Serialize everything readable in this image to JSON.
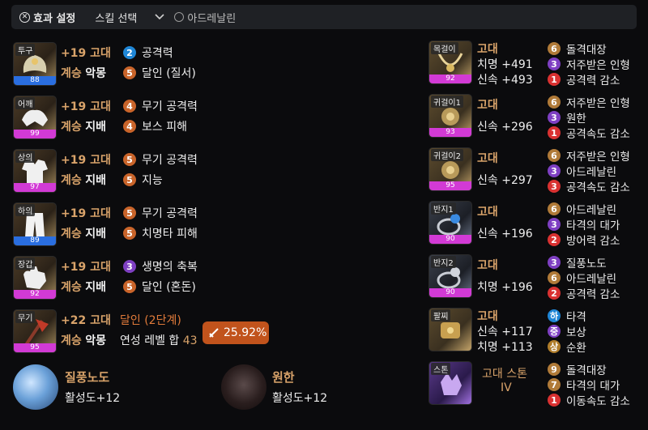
{
  "topbar": {
    "effects_label": "효과 설정",
    "skill_select_label": "스킬 선택",
    "adrenaline_label": "아드레날린"
  },
  "armor": [
    {
      "slot": "투구",
      "quality": "88",
      "quality_color": "blue",
      "upgrade": "+19 고대",
      "succession": "계승",
      "set_name": "악몽",
      "effects": [
        {
          "level": "2",
          "color": "#1f86d6",
          "text": "공격력"
        },
        {
          "level": "5",
          "color": "#c9642a",
          "text": "달인 (질서)"
        }
      ]
    },
    {
      "slot": "어깨",
      "quality": "99",
      "quality_color": "pink",
      "upgrade": "+19 고대",
      "succession": "계승",
      "set_name": "지배",
      "effects": [
        {
          "level": "4",
          "color": "#c9642a",
          "text": "무기 공격력"
        },
        {
          "level": "4",
          "color": "#c9642a",
          "text": "보스 피해"
        }
      ]
    },
    {
      "slot": "상의",
      "quality": "97",
      "quality_color": "pink",
      "upgrade": "+19 고대",
      "succession": "계승",
      "set_name": "지배",
      "effects": [
        {
          "level": "5",
          "color": "#c9642a",
          "text": "무기 공격력"
        },
        {
          "level": "5",
          "color": "#c9642a",
          "text": "지능"
        }
      ]
    },
    {
      "slot": "하의",
      "quality": "89",
      "quality_color": "blue",
      "upgrade": "+19 고대",
      "succession": "계승",
      "set_name": "지배",
      "effects": [
        {
          "level": "5",
          "color": "#c9642a",
          "text": "무기 공격력"
        },
        {
          "level": "5",
          "color": "#c9642a",
          "text": "치명타 피해"
        }
      ]
    },
    {
      "slot": "장갑",
      "quality": "92",
      "quality_color": "pink",
      "upgrade": "+19 고대",
      "succession": "계승",
      "set_name": "지배",
      "effects": [
        {
          "level": "3",
          "color": "#7e3fc2",
          "text": "생명의 축복"
        },
        {
          "level": "5",
          "color": "#c9642a",
          "text": "달인 (혼돈)"
        }
      ]
    }
  ],
  "weapon": {
    "slot": "무기",
    "quality": "95",
    "quality_color": "pink",
    "upgrade": "+22 고대",
    "succession": "계승",
    "set_name": "악몽",
    "effect_name": "달인 (2단계)",
    "level_sum_label": "연성 레벨 합",
    "level_sum": "43",
    "buff_value": "25.92%"
  },
  "runes": [
    {
      "name": "질풍노도",
      "value": "활성도+12"
    },
    {
      "name": "원한",
      "value": "활성도+12"
    }
  ],
  "accessories": [
    {
      "slot": "목걸이",
      "quality": "92",
      "quality_color": "pink",
      "grade": "고대",
      "stats": [
        "치명 +491",
        "신속 +493"
      ],
      "effects": [
        {
          "level": "6",
          "color": "#b07a38",
          "text": "돌격대장"
        },
        {
          "level": "3",
          "color": "#7e3fc2",
          "text": "저주받은 인형"
        },
        {
          "level": "1",
          "color": "#d93131",
          "text": "공격력 감소"
        }
      ]
    },
    {
      "slot": "귀걸이1",
      "quality": "93",
      "quality_color": "pink",
      "grade": "고대",
      "stats": [
        "신속 +296"
      ],
      "effects": [
        {
          "level": "6",
          "color": "#b07a38",
          "text": "저주받은 인형"
        },
        {
          "level": "3",
          "color": "#7e3fc2",
          "text": "원한"
        },
        {
          "level": "1",
          "color": "#d93131",
          "text": "공격속도 감소"
        }
      ]
    },
    {
      "slot": "귀걸이2",
      "quality": "95",
      "quality_color": "pink",
      "grade": "고대",
      "stats": [
        "신속 +297"
      ],
      "effects": [
        {
          "level": "6",
          "color": "#b07a38",
          "text": "저주받은 인형"
        },
        {
          "level": "3",
          "color": "#7e3fc2",
          "text": "아드레날린"
        },
        {
          "level": "3",
          "color": "#d93131",
          "text": "공격속도 감소"
        }
      ]
    },
    {
      "slot": "반지1",
      "quality": "90",
      "quality_color": "pink",
      "grade": "고대",
      "stats": [
        "신속 +196"
      ],
      "effects": [
        {
          "level": "6",
          "color": "#b07a38",
          "text": "아드레날린"
        },
        {
          "level": "3",
          "color": "#7e3fc2",
          "text": "타격의 대가"
        },
        {
          "level": "2",
          "color": "#d93131",
          "text": "방어력 감소"
        }
      ]
    },
    {
      "slot": "반지2",
      "quality": "90",
      "quality_color": "pink",
      "grade": "고대",
      "stats": [
        "치명 +196"
      ],
      "effects": [
        {
          "level": "3",
          "color": "#7e3fc2",
          "text": "질풍노도"
        },
        {
          "level": "6",
          "color": "#b07a38",
          "text": "아드레날린"
        },
        {
          "level": "2",
          "color": "#d93131",
          "text": "공격력 감소"
        }
      ]
    },
    {
      "slot": "팔찌",
      "quality": "",
      "quality_color": "pink",
      "grade": "고대",
      "stats": [
        "신속 +117",
        "치명 +113"
      ],
      "effects": [
        {
          "level": "하",
          "color": "#1f86d6",
          "text": "타격"
        },
        {
          "level": "중",
          "color": "#7e3fc2",
          "text": "보상"
        },
        {
          "level": "상",
          "color": "#c9842a",
          "text": "순환"
        }
      ]
    },
    {
      "slot": "스톤",
      "quality": "",
      "quality_color": "pink",
      "grade": "고대 스톤",
      "grade2": "IV",
      "stats": [],
      "effects": [
        {
          "level": "9",
          "color": "#b07a38",
          "text": "돌격대장"
        },
        {
          "level": "7",
          "color": "#b07a38",
          "text": "타격의 대가"
        },
        {
          "level": "1",
          "color": "#d93131",
          "text": "이동속도 감소"
        }
      ]
    }
  ]
}
